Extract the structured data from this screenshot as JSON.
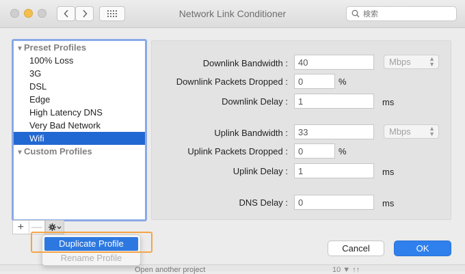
{
  "window": {
    "title": "Network Link Conditioner",
    "search_placeholder": "検索"
  },
  "nav": {
    "back_icon": "chevron-left-icon",
    "forward_icon": "chevron-right-icon",
    "grid_icon": "grid-icon"
  },
  "profiles": {
    "preset_header": "Preset Profiles",
    "preset_items": [
      "100% Loss",
      "3G",
      "DSL",
      "Edge",
      "High Latency DNS",
      "Very Bad Network",
      "Wifi"
    ],
    "selected": "Wifi",
    "custom_header": "Custom Profiles"
  },
  "list_controls": {
    "add": "+",
    "remove": "—",
    "gear_icon": "gear-icon"
  },
  "context_menu": {
    "duplicate": "Duplicate Profile",
    "rename": "Rename Profile"
  },
  "settings": {
    "downlink_bandwidth_label": "Downlink Bandwidth :",
    "downlink_bandwidth_value": "40",
    "downlink_bandwidth_unit": "Mbps",
    "downlink_dropped_label": "Downlink Packets Dropped :",
    "downlink_dropped_value": "0",
    "downlink_dropped_unit": "%",
    "downlink_delay_label": "Downlink Delay :",
    "downlink_delay_value": "1",
    "downlink_delay_unit": "ms",
    "uplink_bandwidth_label": "Uplink Bandwidth :",
    "uplink_bandwidth_value": "33",
    "uplink_bandwidth_unit": "Mbps",
    "uplink_dropped_label": "Uplink Packets Dropped :",
    "uplink_dropped_value": "0",
    "uplink_dropped_unit": "%",
    "uplink_delay_label": "Uplink Delay :",
    "uplink_delay_value": "1",
    "uplink_delay_unit": "ms",
    "dns_delay_label": "DNS Delay :",
    "dns_delay_value": "0",
    "dns_delay_unit": "ms"
  },
  "buttons": {
    "cancel": "Cancel",
    "ok": "OK"
  },
  "background": {
    "peek_text": "Open another project",
    "peek_text2": "10 ▼ ↑↑"
  },
  "colors": {
    "selection": "#2268d2",
    "focus_ring": "#8aa9e6",
    "highlight_box": "#f5a346",
    "ok_button": "#2f80ed"
  }
}
